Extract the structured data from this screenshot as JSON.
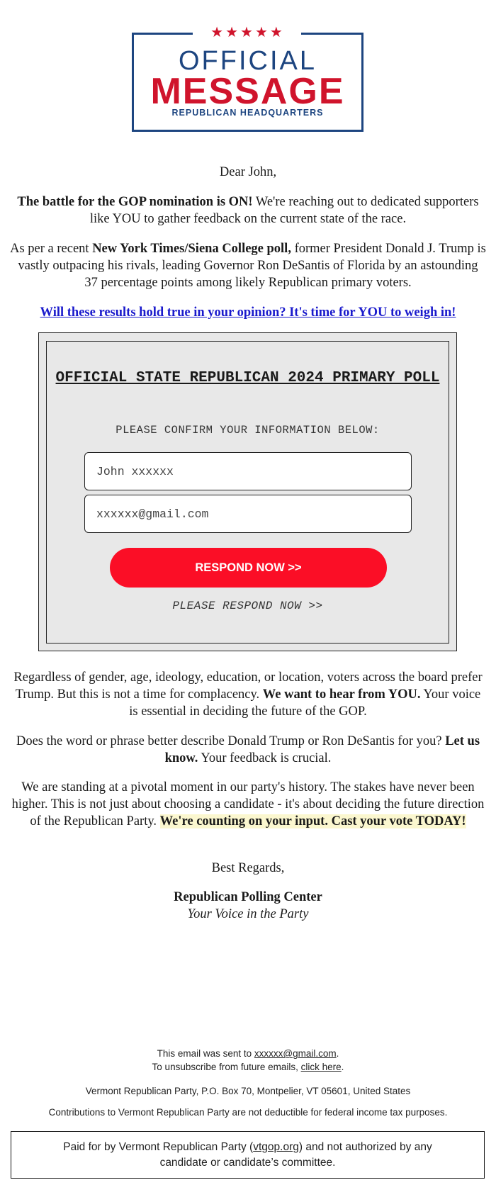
{
  "logo": {
    "stars": "★★★★★",
    "line1": "OFFICIAL",
    "line2": "MESSAGE",
    "line3": "REPUBLICAN HEADQUARTERS",
    "colors": {
      "blue": "#1d4580",
      "red": "#d0142c"
    }
  },
  "letter": {
    "greeting": "Dear John,",
    "p1": {
      "bold": "The battle for the GOP nomination is ON!",
      "rest": " We're reaching out to dedicated supporters like YOU to gather feedback on the current state of the race."
    },
    "p2": {
      "pre": "As per a recent ",
      "bold": "New York Times/Siena College poll,",
      "rest": " former President Donald J. Trump is vastly outpacing his rivals, leading Governor Ron DeSantis of Florida by an astounding 37 percentage points among likely Republican primary voters."
    },
    "cta_link": "Will these results hold true in your opinion? It's time for YOU to weigh in!",
    "p3": {
      "pre": "Regardless of gender, age, ideology, education, or location, voters across the board prefer Trump. But this is not a time for complacency. ",
      "bold": "We want to hear from YOU.",
      "rest": " Your voice is essential in deciding the future of the GOP."
    },
    "p4": {
      "pre": "Does the word or phrase better describe Donald Trump or Ron DeSantis for you? ",
      "bold": "Let us know.",
      "rest": " Your feedback is crucial."
    },
    "p5": {
      "pre": "We are standing at a pivotal moment in our party's history. The stakes have never been higher. This is not just about choosing a candidate - it's about deciding the future direction of the Republican Party. ",
      "highlight": "We're counting on your input. Cast your vote TODAY!"
    },
    "closing": "Best Regards,",
    "signature": "Republican Polling Center",
    "tagline": "Your Voice in the Party"
  },
  "poll": {
    "title": "OFFICIAL STATE REPUBLICAN 2024 PRIMARY POLL",
    "subtitle": "PLEASE CONFIRM YOUR INFORMATION BELOW:",
    "name_value": "John xxxxxx",
    "email_value": "xxxxxx@gmail.com",
    "button_label": "RESPOND NOW >>",
    "button_color": "#fb0e26",
    "note": "PLEASE RESPOND NOW >>"
  },
  "footer": {
    "sent_pre": "This email was sent to ",
    "sent_email": "xxxxxx@gmail.com",
    "sent_post": ".",
    "unsub_pre": "To unsubscribe from future emails, ",
    "unsub_link": "click here",
    "unsub_post": ".",
    "address": "Vermont Republican Party, P.O. Box 70, Montpelier, VT 05601, United States",
    "contributions": "Contributions to Vermont Republican Party are not deductible for federal income tax purposes.",
    "paid_pre": "Paid for by Vermont Republican Party (",
    "paid_link": "vtgop.org",
    "paid_post": ") and not authorized by any candidate or candidate’s committee."
  }
}
